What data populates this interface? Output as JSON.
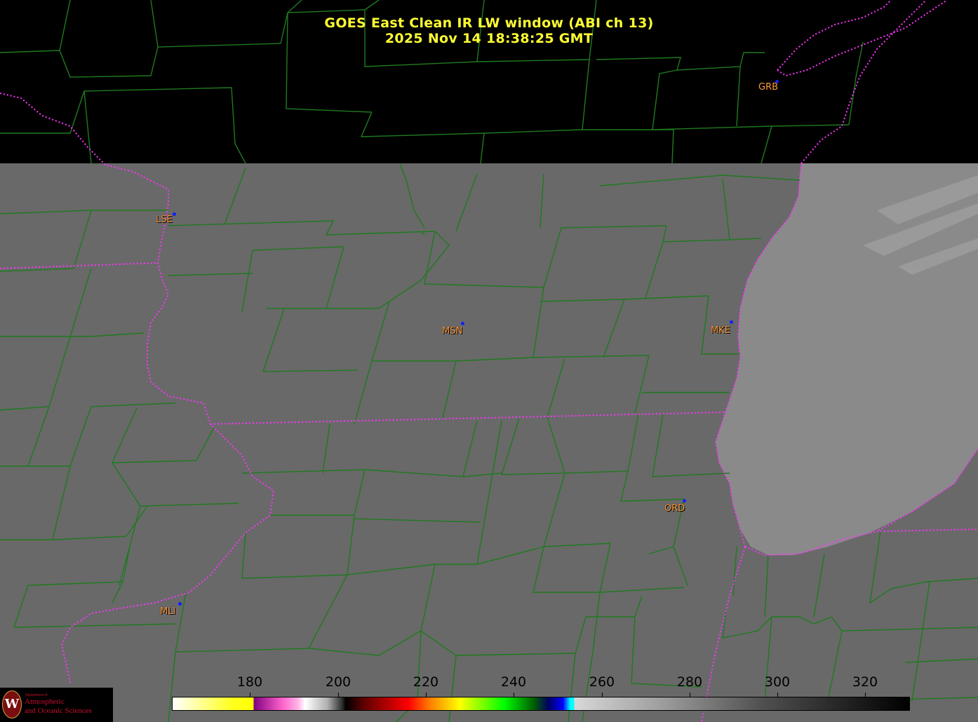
{
  "title": {
    "line1": "GOES East Clean IR LW window (ABI ch 13)",
    "line2": "2025 Nov 14  18:38:25 GMT"
  },
  "cities": [
    {
      "code": "GRB"
    },
    {
      "code": "LSE"
    },
    {
      "code": "MSN"
    },
    {
      "code": "MKE"
    },
    {
      "code": "ORD"
    },
    {
      "code": "MLI"
    }
  ],
  "colorbar": {
    "ticks": [
      "180",
      "200",
      "220",
      "240",
      "260",
      "280",
      "300",
      "320"
    ]
  },
  "logo": {
    "seal_letter": "W",
    "dept": "Department of",
    "line1": "Atmospheric",
    "line2": "and Oceanic Sciences"
  },
  "colors": {
    "title": "#ffff33",
    "county_lines": "#1f7a1f",
    "state_lines": "#ff33ff",
    "city_label": "#ff9a3c",
    "city_marker": "#1020ff",
    "land": "#696969",
    "lake": "#8a8a8a"
  }
}
